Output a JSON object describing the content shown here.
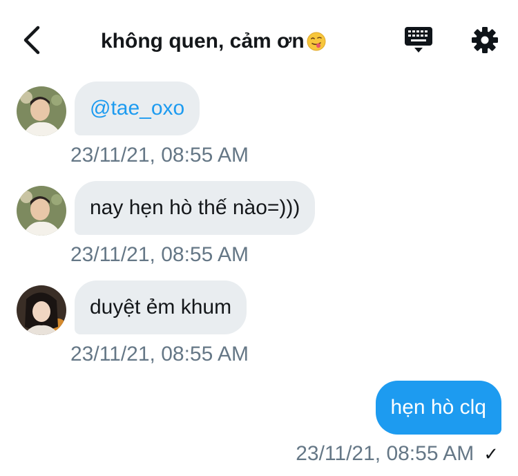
{
  "header": {
    "title": "không quen, cảm ơn",
    "title_emoji": "smiling-face-with-tongue-emoji",
    "back_icon": "chevron-left-icon",
    "keyboard_icon": "keyboard-icon",
    "settings_icon": "gear-icon"
  },
  "messages": [
    {
      "direction": "in",
      "text": "@tae_oxo",
      "is_mention": true,
      "time": "23/11/21, 08:55 AM",
      "avatar": "avatar-1"
    },
    {
      "direction": "in",
      "text": "nay hẹn hò thế nào=)))",
      "is_mention": false,
      "time": "23/11/21, 08:55 AM",
      "avatar": "avatar-1"
    },
    {
      "direction": "in",
      "text": "duyệt ẻm khum",
      "is_mention": false,
      "time": "23/11/21, 08:55 AM",
      "avatar": "avatar-2"
    },
    {
      "direction": "out",
      "text": "hẹn hò clq",
      "is_mention": false,
      "time": "23/11/21, 08:55 AM",
      "status": "✓"
    }
  ],
  "colors": {
    "accent": "#1d9bf0",
    "incoming_bubble": "#e9edf0",
    "timestamp": "#657786",
    "text": "#14171a"
  }
}
